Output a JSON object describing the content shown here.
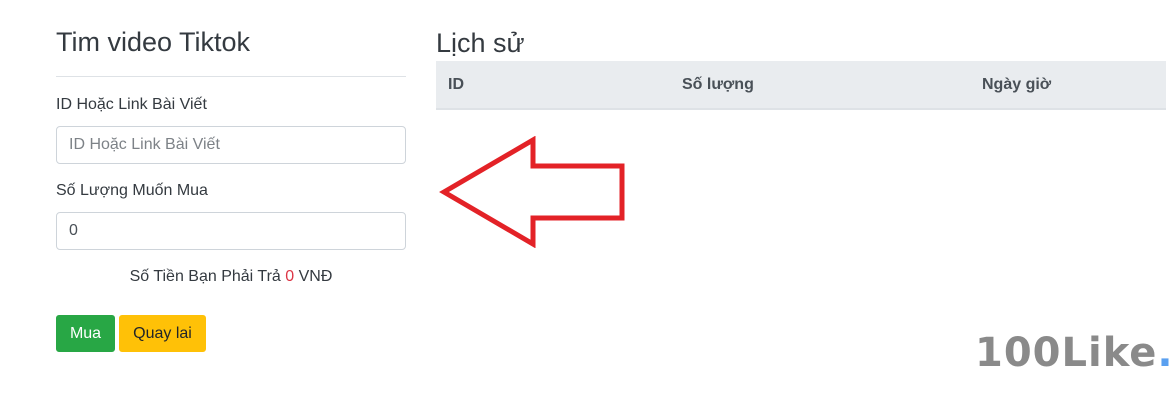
{
  "form": {
    "title": "Tim video Tiktok",
    "link_label": "ID Hoặc Link Bài Viết",
    "link_placeholder": "ID Hoặc Link Bài Viết",
    "link_value": "",
    "qty_label": "Số Lượng Muốn Mua",
    "qty_value": "0",
    "price_prefix": "Số Tiền Bạn Phải Trả",
    "price_amount": "0",
    "price_currency": "VNĐ",
    "buy_label": "Mua",
    "back_label": "Quay lai"
  },
  "history": {
    "title": "Lịch sử",
    "columns": [
      "ID",
      "Số lượng",
      "Ngày giờ"
    ],
    "rows": []
  },
  "annotation": {
    "arrow_icon": "left-arrow-icon",
    "color": "#e32227"
  },
  "brand": {
    "name": "100Like",
    "dot": ".",
    "dot_color": "#5aa0f0"
  },
  "colors": {
    "buy_button": "#28a745",
    "back_button": "#ffc107",
    "price_amount": "#dc3545"
  }
}
